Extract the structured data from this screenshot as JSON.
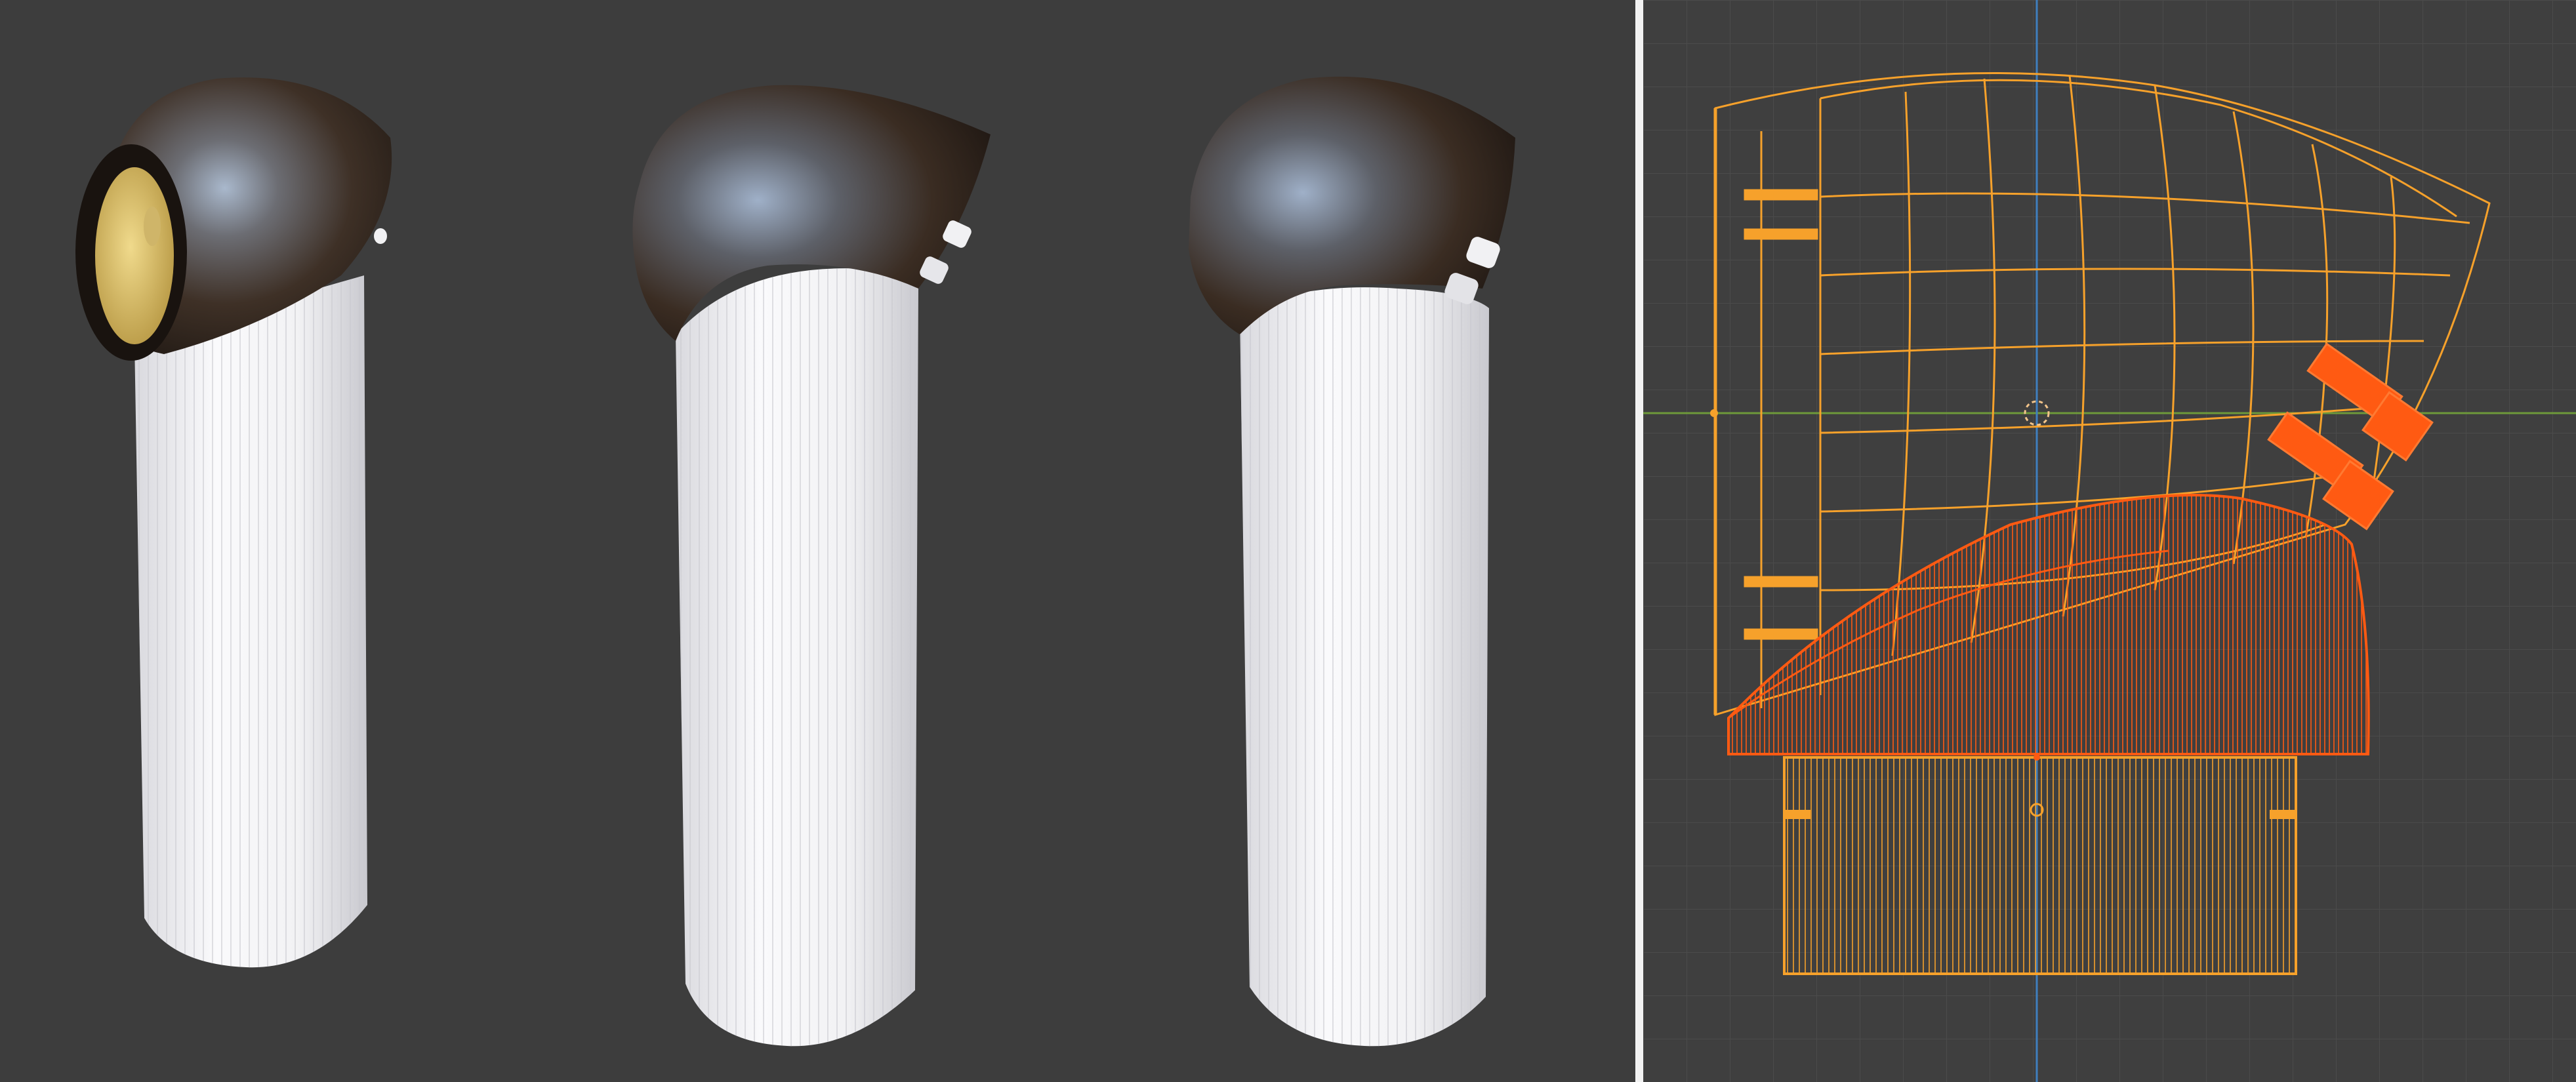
{
  "window": {
    "app_name": "",
    "left_viewport": {
      "mode": "rendered",
      "background": "#3d3d3d"
    },
    "right_viewport": {
      "mode": "wireframe",
      "background": "#3f3f3f",
      "grid": true
    }
  },
  "colors": {
    "handle_white": "#f1f1f3",
    "head_dark": "#3a2c22",
    "head_highlight": "#8fa5c2",
    "brass": "#d8c06a",
    "wire_orange": "#f6a12b",
    "wire_selected": "#ff5a12",
    "grid_line": "#4b4b4b",
    "axis_x": "#6e9a3a",
    "axis_y": "#3f7fbf",
    "divider": "#f2f2f2"
  },
  "objects": [
    {
      "name_icon": "hair-dryer-front-view",
      "visible": true
    },
    {
      "name_icon": "hair-dryer-side-view",
      "visible": true
    },
    {
      "name_icon": "hair-dryer-rear-view",
      "visible": true
    }
  ],
  "wireframe": {
    "selected_parts": [
      "nozzle-tips",
      "neck"
    ]
  }
}
